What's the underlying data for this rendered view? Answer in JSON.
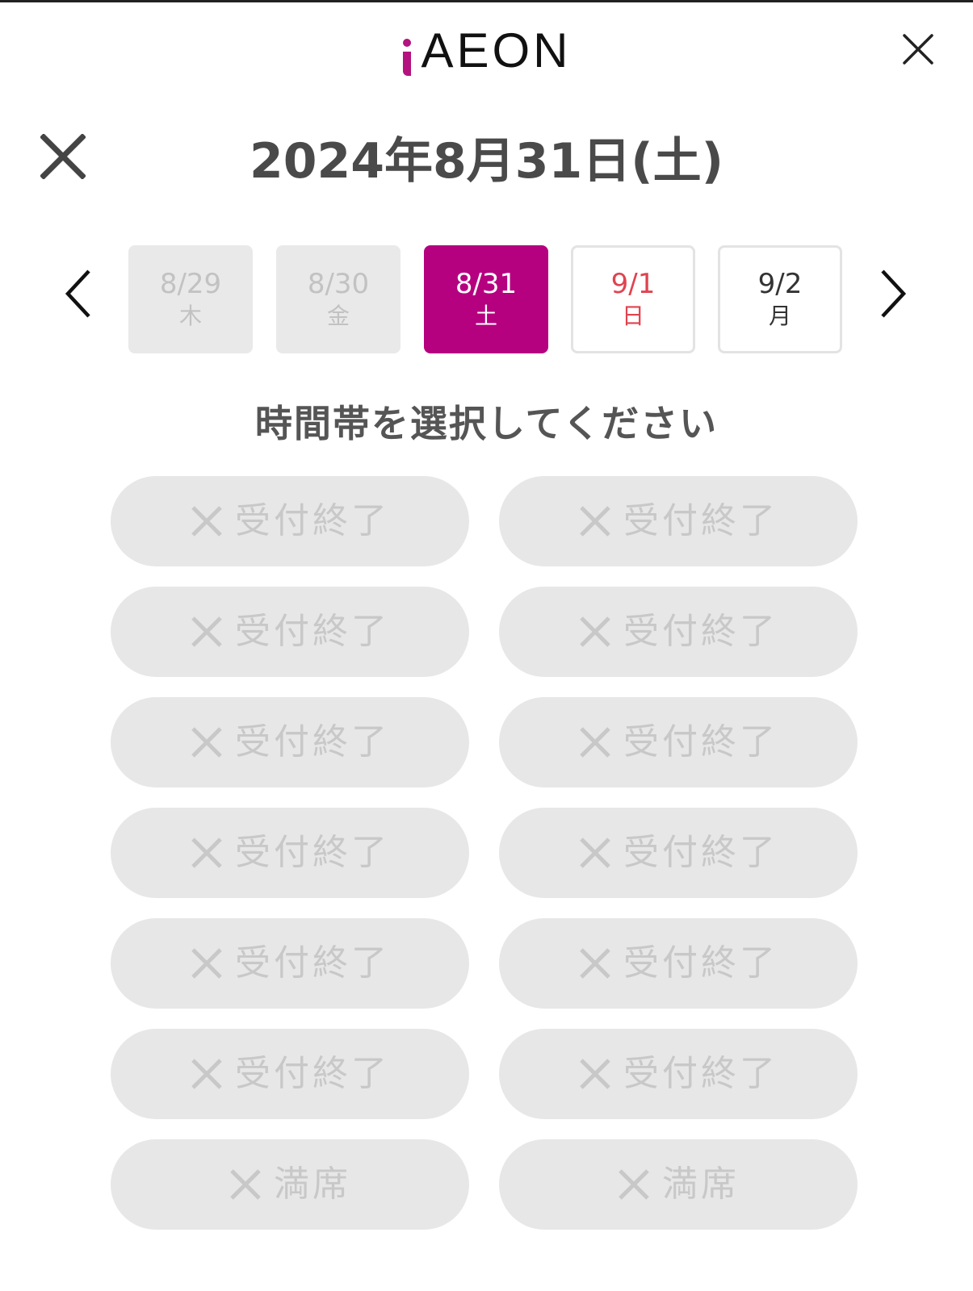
{
  "header": {
    "logo_text": "AEON",
    "logo_color": "#b3127f"
  },
  "title": "2024年8月31日(土)",
  "dates": [
    {
      "date": "8/29",
      "weekday": "木",
      "state": "past"
    },
    {
      "date": "8/30",
      "weekday": "金",
      "state": "past"
    },
    {
      "date": "8/31",
      "weekday": "土",
      "state": "selected"
    },
    {
      "date": "9/1",
      "weekday": "日",
      "state": "open-sunday"
    },
    {
      "date": "9/2",
      "weekday": "月",
      "state": "open"
    }
  ],
  "prompt": "時間帯を選択してください",
  "slots": [
    {
      "status": "受付終了"
    },
    {
      "status": "受付終了"
    },
    {
      "status": "受付終了"
    },
    {
      "status": "受付終了"
    },
    {
      "status": "受付終了"
    },
    {
      "status": "受付終了"
    },
    {
      "status": "受付終了"
    },
    {
      "status": "受付終了"
    },
    {
      "status": "受付終了"
    },
    {
      "status": "受付終了"
    },
    {
      "status": "受付終了"
    },
    {
      "status": "受付終了"
    },
    {
      "status": "満席"
    },
    {
      "status": "満席"
    }
  ],
  "colors": {
    "accent": "#b5007f",
    "sunday": "#e0434f",
    "disabled_bg": "#e7e7e7",
    "disabled_text": "#c8c8c8"
  },
  "icons": {
    "close": "close-icon",
    "prev": "chevron-left-icon",
    "next": "chevron-right-icon",
    "unavailable": "x-mark-icon"
  }
}
